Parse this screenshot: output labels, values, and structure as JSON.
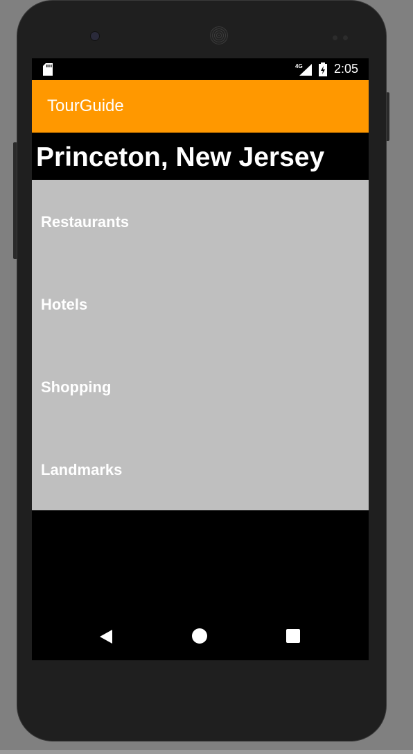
{
  "status_bar": {
    "network_label": "4G",
    "time": "2:05"
  },
  "app_bar": {
    "title": "TourGuide",
    "color": "#ff9800"
  },
  "city": {
    "title": "Princeton, New Jersey"
  },
  "categories": [
    {
      "label": "Restaurants"
    },
    {
      "label": "Hotels"
    },
    {
      "label": "Shopping"
    },
    {
      "label": "Landmarks"
    }
  ],
  "nav_bar": {
    "back_icon": "back-triangle-icon",
    "home_icon": "home-circle-icon",
    "recents_icon": "recents-square-icon"
  },
  "colors": {
    "list_background": "#bfbfbf",
    "screen_background": "#000000",
    "frame_background": "#808080"
  }
}
